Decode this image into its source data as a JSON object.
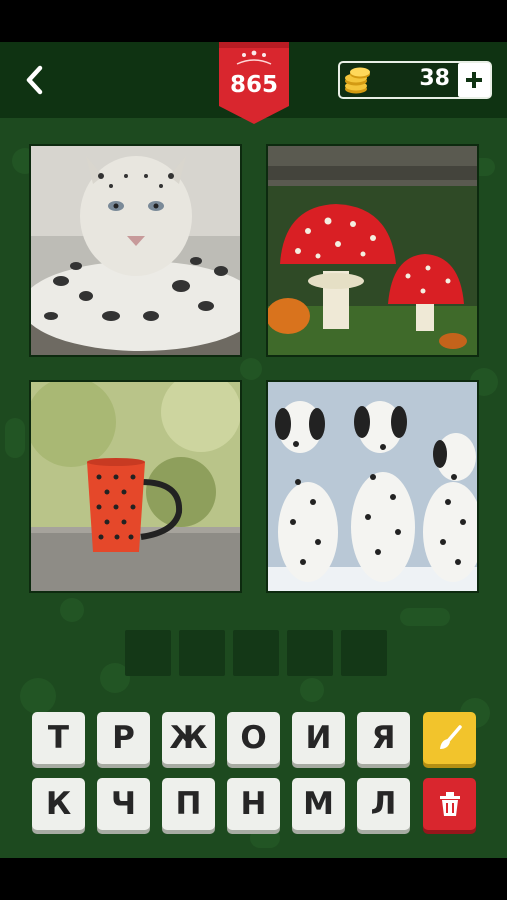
{
  "level": "865",
  "coins": "38",
  "pictures": [
    {
      "subject": "snow-leopard"
    },
    {
      "subject": "fly-agaric-mushrooms"
    },
    {
      "subject": "polka-dot-mug"
    },
    {
      "subject": "dalmatian-dogs"
    }
  ],
  "answer_slots": [
    "",
    "",
    "",
    "",
    ""
  ],
  "keyboard": {
    "row1": [
      "Т",
      "Р",
      "Ж",
      "О",
      "И",
      "Я"
    ],
    "row2": [
      "К",
      "Ч",
      "П",
      "Н",
      "М",
      "Л"
    ]
  },
  "colors": {
    "board": "#1d4a1f",
    "header": "#0f3312",
    "badge": "#d9262e",
    "hint": "#f2c42c",
    "trash": "#d9262e"
  },
  "icons": {
    "back": "chevron-left-icon",
    "coin": "coin-stack-icon",
    "plus": "plus-icon",
    "hint": "paintbrush-icon",
    "delete": "trash-icon"
  }
}
